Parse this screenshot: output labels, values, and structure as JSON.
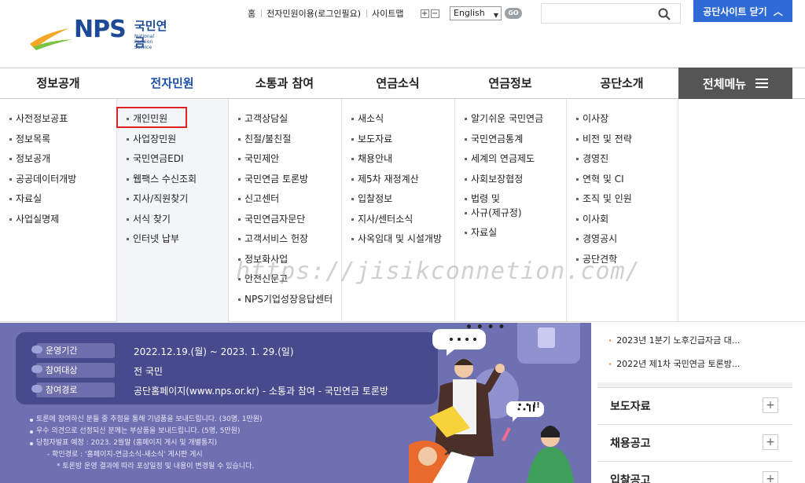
{
  "logo": {
    "mark": "NPS",
    "ko": "국민연금",
    "en": "National Pension Service"
  },
  "util": {
    "links": [
      "홈",
      "전자민원이용(로그인필요)",
      "사이트맵"
    ],
    "zoom_in": "+",
    "zoom_out": "−",
    "language": "English",
    "go": "GO",
    "close_button": "공단사이트 닫기"
  },
  "gnb": {
    "items": [
      "정보공개",
      "전자민원",
      "소통과 참여",
      "연금소식",
      "연금정보",
      "공단소개"
    ],
    "all_menu": "전체메뉴"
  },
  "menu": {
    "col1": [
      "사전정보공표",
      "정보목록",
      "정보공개",
      "공공데이터개방",
      "자료실",
      "사업실명제"
    ],
    "col2": [
      "개인민원",
      "사업장민원",
      "국민연금EDI",
      "웹팩스 수신조회",
      "지사/직원찾기",
      "서식 찾기",
      "인터넷 납부"
    ],
    "col3": [
      "고객상담실",
      "친절/불친절",
      "국민제안",
      "국민연금 토론방",
      "신고센터",
      "국민연금자문단",
      "고객서비스 헌장",
      "정보화사업",
      "안전신문고",
      "NPS기업성장응답센터"
    ],
    "col4": [
      "새소식",
      "보도자료",
      "채용안내",
      "제5차 재정계산",
      "입찰정보",
      "지사/센터소식",
      "사옥임대 및 시설개방"
    ],
    "col5": [
      "알기쉬운 국민연금",
      "국민연금통계",
      "세계의 연금제도",
      "사회보장협정",
      "법령 및",
      "사규(제규정)",
      "자료실"
    ],
    "col6": [
      "이사장",
      "비전 및 전략",
      "경영진",
      "연혁 및 CI",
      "조직 및 인원",
      "이사회",
      "경영공시",
      "공단견학"
    ]
  },
  "watermark": "https://jisikconnetion.com/",
  "banner": {
    "rows": [
      {
        "tag": "운영기간",
        "value": "2022.12.19.(월) ~ 2023. 1. 29.(일)"
      },
      {
        "tag": "참여대상",
        "value": "전 국민"
      },
      {
        "tag": "참여경로",
        "value": "공단홈페이지(www.nps.or.kr) - 소통과 참여 - 국민연금 토론방"
      }
    ],
    "notes": [
      "토론에 참여하신 분들 중 추첨을 통해 기념품을 보내드립니다. (30명, 1만원)",
      "우수 의견으로 선정되신 분께는 부상품을 보내드립니다. (5명, 5만원)",
      "당첨자발표 예정 : 2023. 2월말 (홈페이지 게시 및 개별통지)",
      "- 확인경로 : '홈페이지-연금소식-새소식' 게시판 게시",
      "* 토론방 운영 결과에 따라 포상일정 및 내용이 변경될 수 있습니다."
    ],
    "bubble_dots": "• • • •",
    "bubble_excl": "• • !!"
  },
  "sidebar": {
    "news": [
      "2023년 1분기 노후긴급자금 대...",
      "2022년 제1차 국민연금 토론방..."
    ],
    "accordion": [
      "보도자료",
      "채용공고",
      "입찰공고"
    ],
    "plus": "+"
  },
  "colors": {
    "brand": "#1d4a96",
    "accent": "#2f6bd6",
    "banner": "#6e70b2",
    "highlight": "#e02222"
  }
}
